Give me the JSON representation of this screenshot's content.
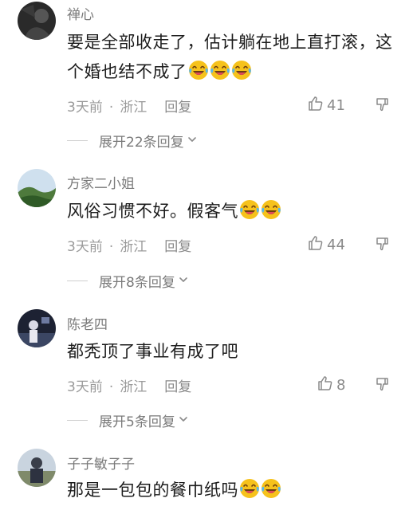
{
  "comments": [
    {
      "username": "禅心",
      "text": "要是全部收走了，估计躺在地上直打滚，这个婚也结不成了",
      "emoji_count": 3,
      "time": "3天前",
      "location": "浙江",
      "reply_label": "回复",
      "likes": "41",
      "expand_label": "展开22条回复"
    },
    {
      "username": "方家二小姐",
      "text": "风俗习惯不好。假客气",
      "emoji_count": 2,
      "time": "3天前",
      "location": "浙江",
      "reply_label": "回复",
      "likes": "44",
      "expand_label": "展开8条回复"
    },
    {
      "username": "陈老四",
      "text": "都秃顶了事业有成了吧",
      "emoji_count": 0,
      "time": "3天前",
      "location": "浙江",
      "reply_label": "回复",
      "likes": "8",
      "expand_label": "展开5条回复"
    },
    {
      "username": "子子敏子子",
      "text": "那是一包包的餐巾纸吗",
      "emoji_count": 2
    }
  ],
  "separator": "·",
  "icons": {
    "like": "thumbs-up-icon",
    "dislike": "thumbs-down-icon",
    "expand": "chevron-down-icon",
    "emoji": "laughing-crying-emoji-icon"
  },
  "colors": {
    "text": "#1c1c1c",
    "meta": "#9a9a9a",
    "emoji": "#f6c21c"
  }
}
